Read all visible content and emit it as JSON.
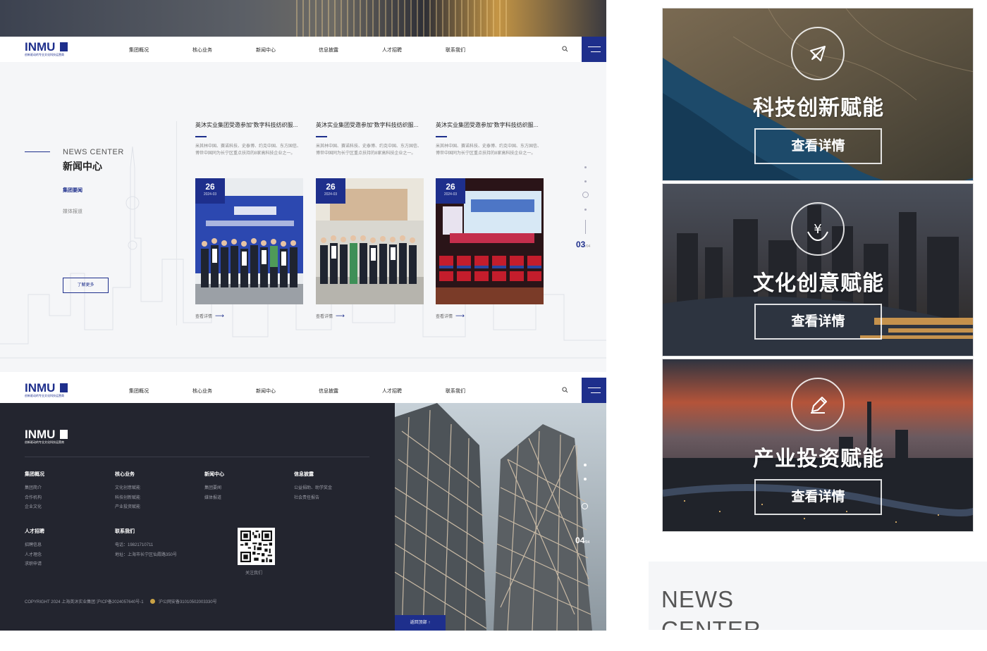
{
  "logo": {
    "word": "INMU",
    "tagline": "创新驱动的专业文化科技运营商"
  },
  "nav": {
    "items": [
      "集团概况",
      "核心业务",
      "新闻中心",
      "信息披露",
      "人才招聘",
      "联系我们"
    ]
  },
  "news": {
    "title_en": "NEWS CENTER",
    "title_cn": "新闻中心",
    "categories": [
      "集团要闻",
      "媒体报道"
    ],
    "more_label": "了解更多",
    "cards": [
      {
        "title": "英沐实业集团受邀参加“数字科技纺织服...",
        "desc": "米其林中国、赛诺科技、史泰博、约克中国、东方国信、博世中国同为长宁区重点扶持的8家高科技企业之一。",
        "day": "26",
        "month": "2024-03",
        "link": "查看详情"
      },
      {
        "title": "英沐实业集团受邀参加“数字科技纺织服...",
        "desc": "米其林中国、赛诺科技、史泰博、约克中国、东方国信、博世中国同为长宁区重点扶持的8家高科技企业之一。",
        "day": "26",
        "month": "2024-03",
        "link": "查看详情"
      },
      {
        "title": "英沐实业集团受邀参加“数字科技纺织服...",
        "desc": "米其林中国、赛诺科技、史泰博、约克中国、东方国信、博世中国同为长宁区重点扶持的8家高科技企业之一。",
        "day": "26",
        "month": "2024-03",
        "link": "查看详情"
      }
    ],
    "pager_current": "03",
    "pager_total": "/04"
  },
  "footer": {
    "columns": [
      {
        "head": "集团概况",
        "items": [
          "集团简介",
          "合作机构",
          "企业文化"
        ]
      },
      {
        "head": "核心业务",
        "items": [
          "文化创意赋能",
          "科技创新赋能",
          "产业投资赋能"
        ]
      },
      {
        "head": "新闻中心",
        "items": [
          "集团要闻",
          "媒体报道"
        ]
      },
      {
        "head": "信息披露",
        "items": [
          "公益捐助、助学奖金",
          "社会责任报告"
        ]
      },
      {
        "head": "人才招聘",
        "items": [
          "招聘信息",
          "人才理念",
          "求职申请"
        ]
      },
      {
        "head": "联系我们",
        "items": [
          "电话：19821710711",
          "地址：上海市长宁区仙霞路350号"
        ]
      }
    ],
    "qr_label": "关注我们",
    "copyright": "COPYRIGHT 2024 上海英沐实业集团 沪ICP备2024057640号-1",
    "police": "沪公网安备31010502003330号",
    "back_top": "返回顶部",
    "pager_current": "04",
    "pager_total": "/04"
  },
  "panels": [
    {
      "title": "科技创新赋能",
      "button": "查看详情",
      "icon": "rocket-icon"
    },
    {
      "title": "文化创意赋能",
      "button": "查看详情",
      "icon": "yuan-hand-icon"
    },
    {
      "title": "产业投资赋能",
      "button": "查看详情",
      "icon": "pencil-icon"
    }
  ],
  "news_crop": {
    "text": "NEWS CENTER"
  },
  "colors": {
    "brand": "#1e2f8c",
    "footer_bg": "#23252f",
    "section_bg": "#f5f6f8"
  }
}
